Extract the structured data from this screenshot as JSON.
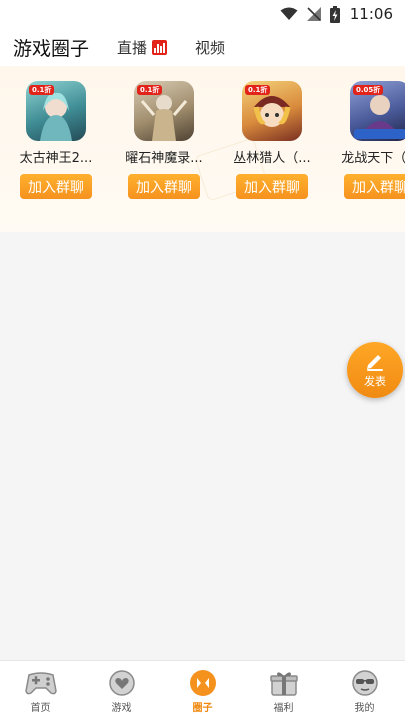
{
  "status_bar": {
    "time": "11:06"
  },
  "top_tabs": [
    {
      "label": "游戏圈子",
      "active": true
    },
    {
      "label": "直播",
      "active": false
    },
    {
      "label": "视频",
      "active": false
    }
  ],
  "groups": [
    {
      "name": "太古神王2...",
      "tag": "0.1折",
      "button": "加入群聊",
      "icon_colors": [
        "#7fc6c7",
        "#2f6f79"
      ]
    },
    {
      "name": "曜石神魔录...",
      "tag": "0.1折",
      "button": "加入群聊",
      "icon_colors": [
        "#b9a687",
        "#5e4f3a"
      ]
    },
    {
      "name": "丛林猎人（...",
      "tag": "0.1折",
      "button": "加入群聊",
      "icon_colors": [
        "#e9b04a",
        "#8a3a2a"
      ]
    },
    {
      "name": "龙战天下（...",
      "tag": "0.05折",
      "button": "加入群聊",
      "icon_colors": [
        "#5b6fb0",
        "#2a2f58"
      ]
    }
  ],
  "fab": {
    "label": "发表"
  },
  "bottom_nav": [
    {
      "label": "首页",
      "icon": "gamepad-icon",
      "active": false
    },
    {
      "label": "游戏",
      "icon": "heart-bubble-icon",
      "active": false
    },
    {
      "label": "圈子",
      "icon": "circle-chat-icon",
      "active": true
    },
    {
      "label": "福利",
      "icon": "gift-icon",
      "active": false
    },
    {
      "label": "我的",
      "icon": "sunglasses-face-icon",
      "active": false
    }
  ],
  "colors": {
    "accent": "#f5921e",
    "live_badge": "#e2231a"
  }
}
